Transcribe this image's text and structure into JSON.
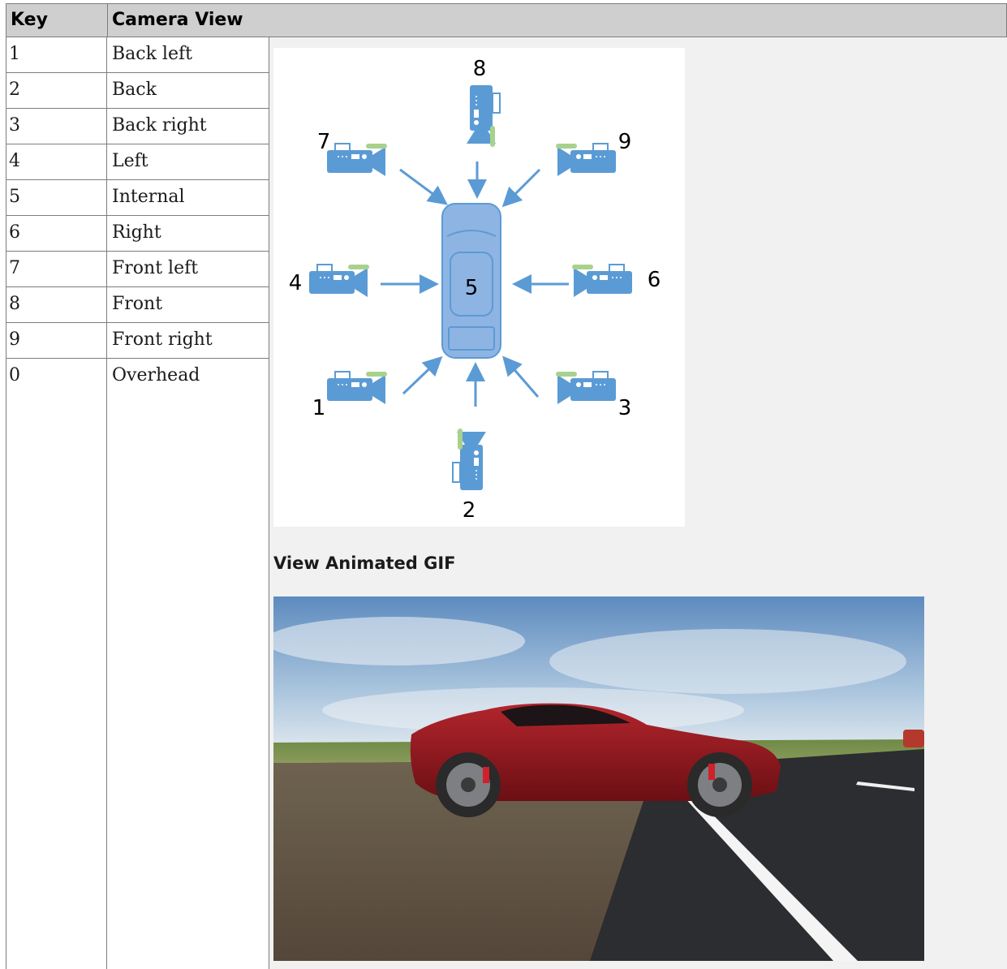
{
  "table": {
    "headers": {
      "key": "Key",
      "view": "Camera View"
    },
    "rows": [
      {
        "key": "1",
        "view": "Back left"
      },
      {
        "key": "2",
        "view": "Back"
      },
      {
        "key": "3",
        "view": "Back right"
      },
      {
        "key": "4",
        "view": "Left"
      },
      {
        "key": "5",
        "view": "Internal"
      },
      {
        "key": "6",
        "view": "Right"
      },
      {
        "key": "7",
        "view": "Front left"
      },
      {
        "key": "8",
        "view": "Front"
      },
      {
        "key": "9",
        "view": "Front right"
      },
      {
        "key": "0",
        "view": "Overhead"
      }
    ]
  },
  "diagram": {
    "labels": {
      "n1": "1",
      "n2": "2",
      "n3": "3",
      "n4": "4",
      "n5": "5",
      "n6": "6",
      "n7": "7",
      "n8": "8",
      "n9": "9"
    },
    "colors": {
      "camera": "#5b9bd5",
      "accent": "#a9d18e",
      "car": "#8eb4e3"
    }
  },
  "gif": {
    "title": "View Animated GIF"
  }
}
